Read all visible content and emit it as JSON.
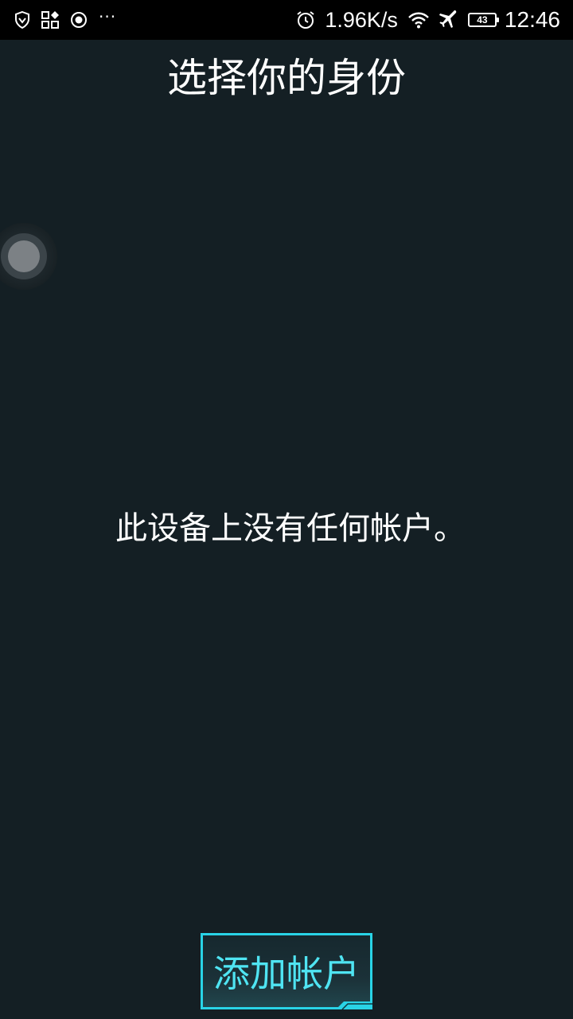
{
  "status_bar": {
    "icons_left": [
      "shield-icon",
      "apps-icon",
      "record-icon"
    ],
    "overflow": "···",
    "alarm_icon": "alarm-clock-icon",
    "net_speed": "1.96K/s",
    "wifi_icon": "wifi-icon",
    "airplane_icon": "airplane-icon",
    "battery_level": "43",
    "time": "12:46"
  },
  "page": {
    "title": "选择你的身份",
    "empty_message": "此设备上没有任何帐户。",
    "add_account_label": "添加帐户"
  },
  "colors": {
    "background": "#141f24",
    "status_bar": "#000000",
    "accent": "#29d3e6",
    "button_text": "#4fe4f2"
  }
}
